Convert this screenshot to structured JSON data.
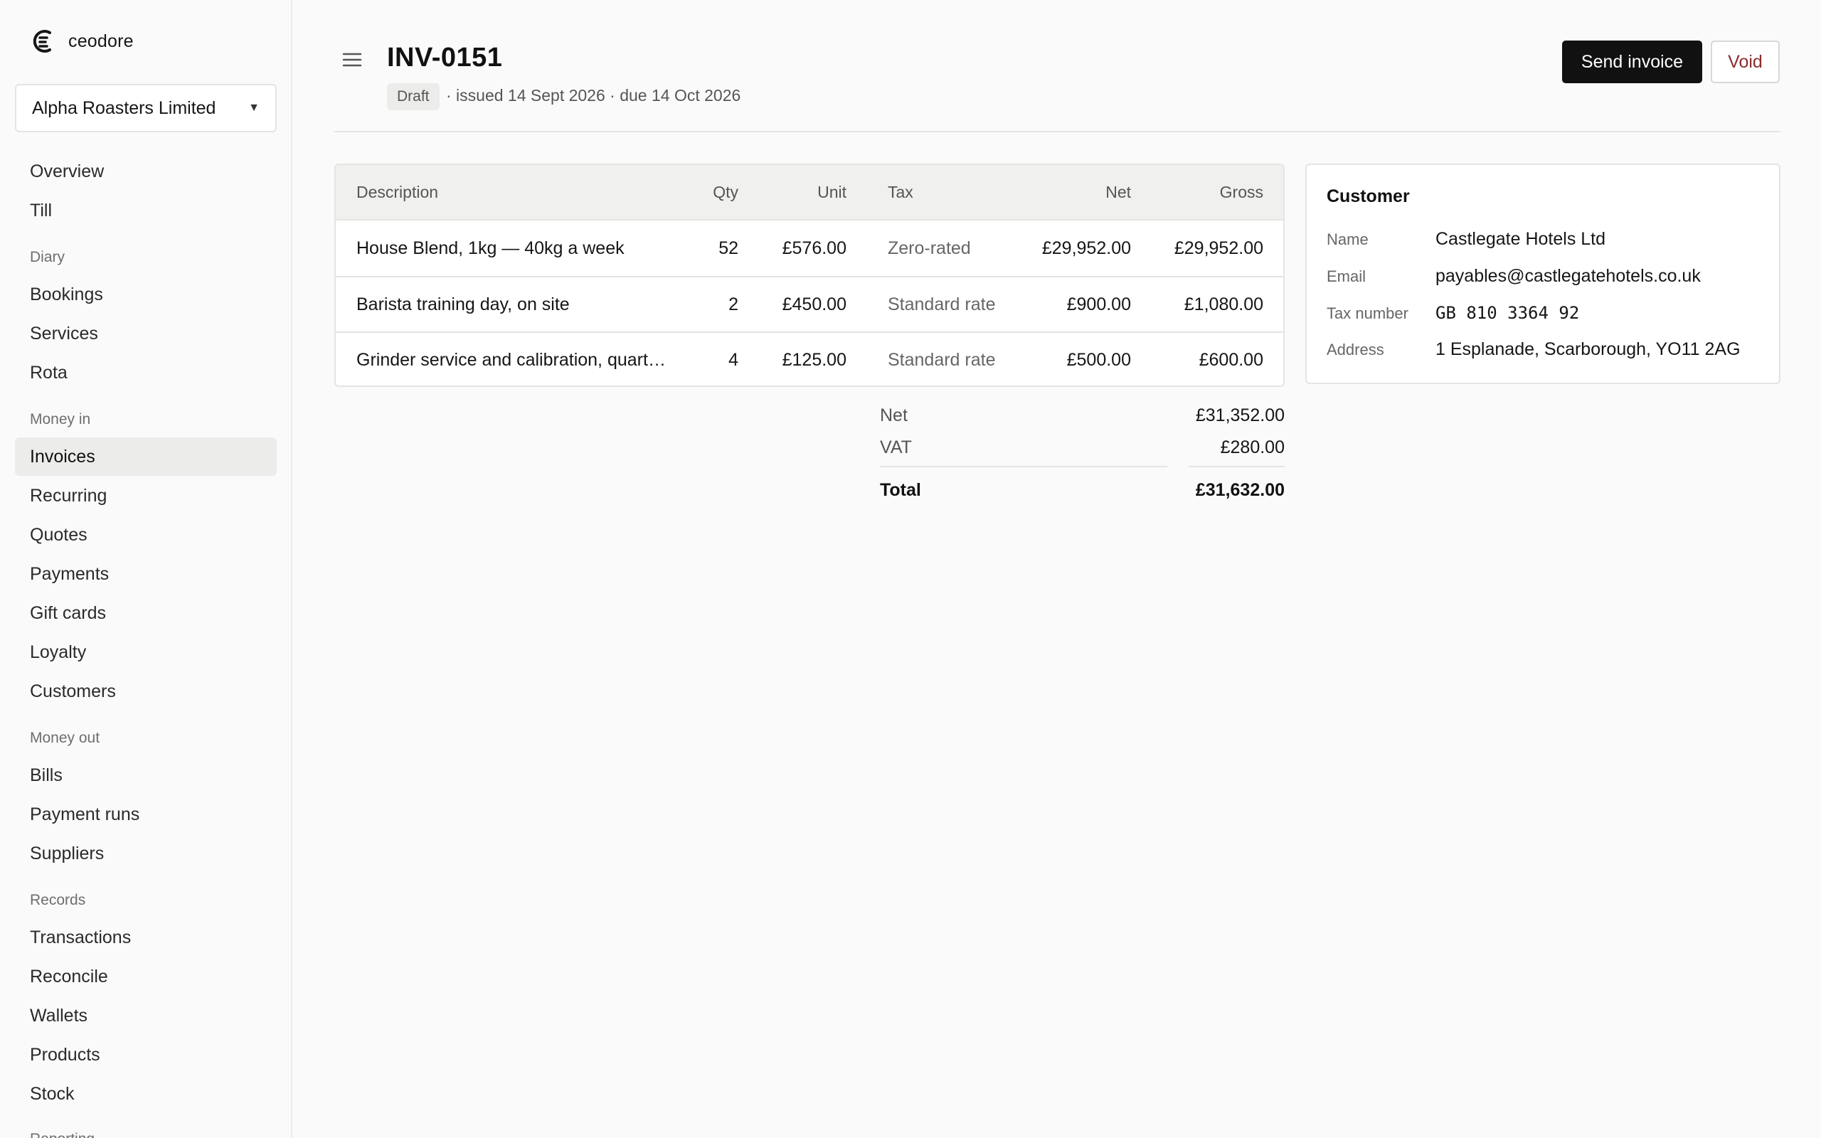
{
  "app": {
    "brand": "ceodore"
  },
  "org_selector": {
    "value": "Alpha Roasters Limited"
  },
  "sidebar": {
    "items": [
      {
        "label": "Overview"
      },
      {
        "label": "Till"
      },
      {
        "section": "Diary"
      },
      {
        "label": "Bookings"
      },
      {
        "label": "Services"
      },
      {
        "label": "Rota"
      },
      {
        "section": "Money in"
      },
      {
        "label": "Invoices",
        "active": true
      },
      {
        "label": "Recurring"
      },
      {
        "label": "Quotes"
      },
      {
        "label": "Payments"
      },
      {
        "label": "Gift cards"
      },
      {
        "label": "Loyalty"
      },
      {
        "label": "Customers"
      },
      {
        "section": "Money out"
      },
      {
        "label": "Bills"
      },
      {
        "label": "Payment runs"
      },
      {
        "label": "Suppliers"
      },
      {
        "section": "Records"
      },
      {
        "label": "Transactions"
      },
      {
        "label": "Reconcile"
      },
      {
        "label": "Wallets"
      },
      {
        "label": "Products"
      },
      {
        "label": "Stock"
      },
      {
        "section": "Reporting"
      }
    ]
  },
  "invoice": {
    "number": "INV-0151",
    "status": "Draft",
    "meta": "· issued 14 Sept 2026 · due 14 Oct 2026",
    "actions": {
      "send": "Send invoice",
      "void": "Void"
    }
  },
  "table": {
    "headers": {
      "description": "Description",
      "qty": "Qty",
      "unit": "Unit",
      "tax": "Tax",
      "net": "Net",
      "gross": "Gross"
    },
    "rows": [
      {
        "description": "House Blend, 1kg — 40kg a week",
        "qty": "52",
        "unit": "£576.00",
        "tax": "Zero-rated",
        "net": "£29,952.00",
        "gross": "£29,952.00"
      },
      {
        "description": "Barista training day, on site",
        "qty": "2",
        "unit": "£450.00",
        "tax": "Standard rate",
        "net": "£900.00",
        "gross": "£1,080.00"
      },
      {
        "description": "Grinder service and calibration, quarterly",
        "qty": "4",
        "unit": "£125.00",
        "tax": "Standard rate",
        "net": "£500.00",
        "gross": "£600.00"
      }
    ]
  },
  "totals": {
    "net_label": "Net",
    "net": "£31,352.00",
    "vat_label": "VAT",
    "vat": "£280.00",
    "total_label": "Total",
    "total": "£31,632.00"
  },
  "customer": {
    "title": "Customer",
    "fields": [
      {
        "label": "Name",
        "value": "Castlegate Hotels Ltd"
      },
      {
        "label": "Email",
        "value": "payables@castlegatehotels.co.uk"
      },
      {
        "label": "Tax number",
        "value": "GB 810 3364 92"
      },
      {
        "label": "Address",
        "value": "1 Esplanade, Scarborough, YO11 2AG"
      }
    ]
  }
}
